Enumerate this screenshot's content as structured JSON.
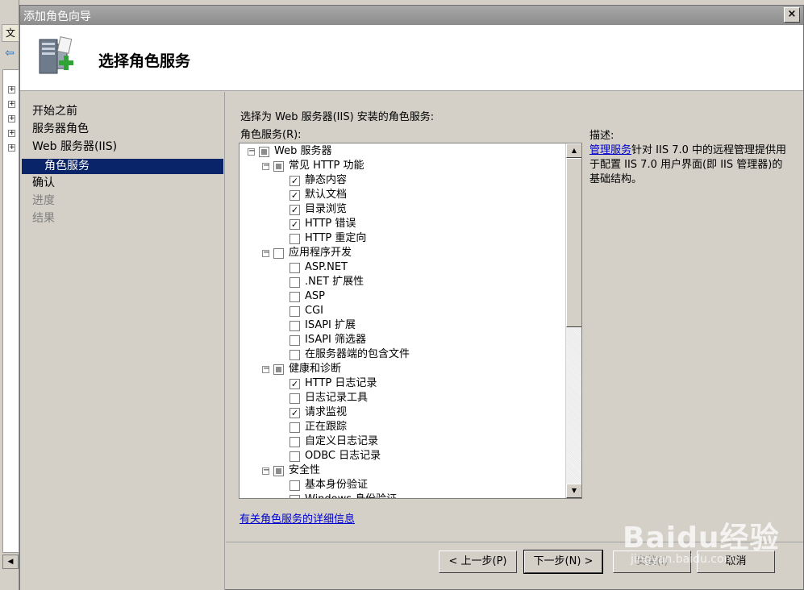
{
  "window": {
    "title": "添加角色向导",
    "close": "×"
  },
  "background": {
    "menu_glyph": "文"
  },
  "header": {
    "title": "选择角色服务"
  },
  "nav": {
    "items": [
      "开始之前",
      "服务器角色",
      "Web 服务器(IIS)",
      "角色服务",
      "确认",
      "进度",
      "结果"
    ],
    "selected_index": 3
  },
  "content": {
    "prompt": "选择为 Web 服务器(IIS) 安装的角色服务:",
    "list_label": "角色服务(R):",
    "tree": [
      {
        "label": "Web 服务器",
        "level": 0,
        "expand": "⊟",
        "state": "partial"
      },
      {
        "label": "常见 HTTP 功能",
        "level": 1,
        "expand": "⊟",
        "state": "partial"
      },
      {
        "label": "静态内容",
        "level": 2,
        "state": "checked"
      },
      {
        "label": "默认文档",
        "level": 2,
        "state": "checked"
      },
      {
        "label": "目录浏览",
        "level": 2,
        "state": "checked"
      },
      {
        "label": "HTTP 错误",
        "level": 2,
        "state": "checked"
      },
      {
        "label": "HTTP 重定向",
        "level": 2,
        "state": "unchecked"
      },
      {
        "label": "应用程序开发",
        "level": 1,
        "expand": "⊟",
        "state": "unchecked"
      },
      {
        "label": "ASP.NET",
        "level": 2,
        "state": "unchecked"
      },
      {
        "label": ".NET 扩展性",
        "level": 2,
        "state": "unchecked"
      },
      {
        "label": "ASP",
        "level": 2,
        "state": "unchecked"
      },
      {
        "label": "CGI",
        "level": 2,
        "state": "unchecked"
      },
      {
        "label": "ISAPI 扩展",
        "level": 2,
        "state": "unchecked"
      },
      {
        "label": "ISAPI 筛选器",
        "level": 2,
        "state": "unchecked"
      },
      {
        "label": "在服务器端的包含文件",
        "level": 2,
        "state": "unchecked"
      },
      {
        "label": "健康和诊断",
        "level": 1,
        "expand": "⊟",
        "state": "partial"
      },
      {
        "label": "HTTP 日志记录",
        "level": 2,
        "state": "checked"
      },
      {
        "label": "日志记录工具",
        "level": 2,
        "state": "unchecked"
      },
      {
        "label": "请求监视",
        "level": 2,
        "state": "checked"
      },
      {
        "label": "正在跟踪",
        "level": 2,
        "state": "unchecked"
      },
      {
        "label": "自定义日志记录",
        "level": 2,
        "state": "unchecked"
      },
      {
        "label": "ODBC 日志记录",
        "level": 2,
        "state": "unchecked"
      },
      {
        "label": "安全性",
        "level": 1,
        "expand": "⊟",
        "state": "partial"
      },
      {
        "label": "基本身份验证",
        "level": 2,
        "state": "unchecked"
      },
      {
        "label": "Windows 身份验证",
        "level": 2,
        "state": "unchecked"
      }
    ],
    "description_title": "描述:",
    "description_link": "管理服务",
    "description_text": "针对 IIS 7.0 中的远程管理提供用于配置 IIS 7.0 用户界面(即 IIS 管理器)的基础结构。",
    "more_info_link": "有关角色服务的详细信息"
  },
  "footer": {
    "back": "< 上一步(P)",
    "next": "下一步(N) >",
    "install": "安装(I)",
    "cancel": "取消"
  },
  "watermark": {
    "brand": "Baidu经验",
    "url": "jingyan.baidu.com"
  }
}
